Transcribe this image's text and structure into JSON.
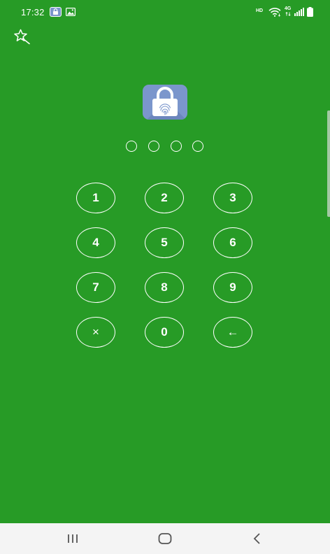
{
  "status_bar": {
    "time": "17:32",
    "hd_label": "HD",
    "network_label": "4G",
    "icons": [
      "app-lock-notification-icon",
      "gallery-notification-icon",
      "wifi-icon",
      "signal-icon",
      "battery-icon"
    ]
  },
  "lock_screen": {
    "theme_button_icon": "magic-wand-icon",
    "app_icon": "padlock-fingerprint-icon",
    "pin_length": 4,
    "keys": [
      {
        "label": "1"
      },
      {
        "label": "2"
      },
      {
        "label": "3"
      },
      {
        "label": "4"
      },
      {
        "label": "5"
      },
      {
        "label": "6"
      },
      {
        "label": "7"
      },
      {
        "label": "8"
      },
      {
        "label": "9"
      },
      {
        "label": "×"
      },
      {
        "label": "0"
      },
      {
        "label": "←"
      }
    ]
  },
  "nav_bar": {
    "icons": [
      "recent-apps-icon",
      "home-icon",
      "back-icon"
    ]
  },
  "colors": {
    "background": "#279b26",
    "app_icon": "#7b96cc",
    "nav_bar": "#f4f4f4"
  }
}
